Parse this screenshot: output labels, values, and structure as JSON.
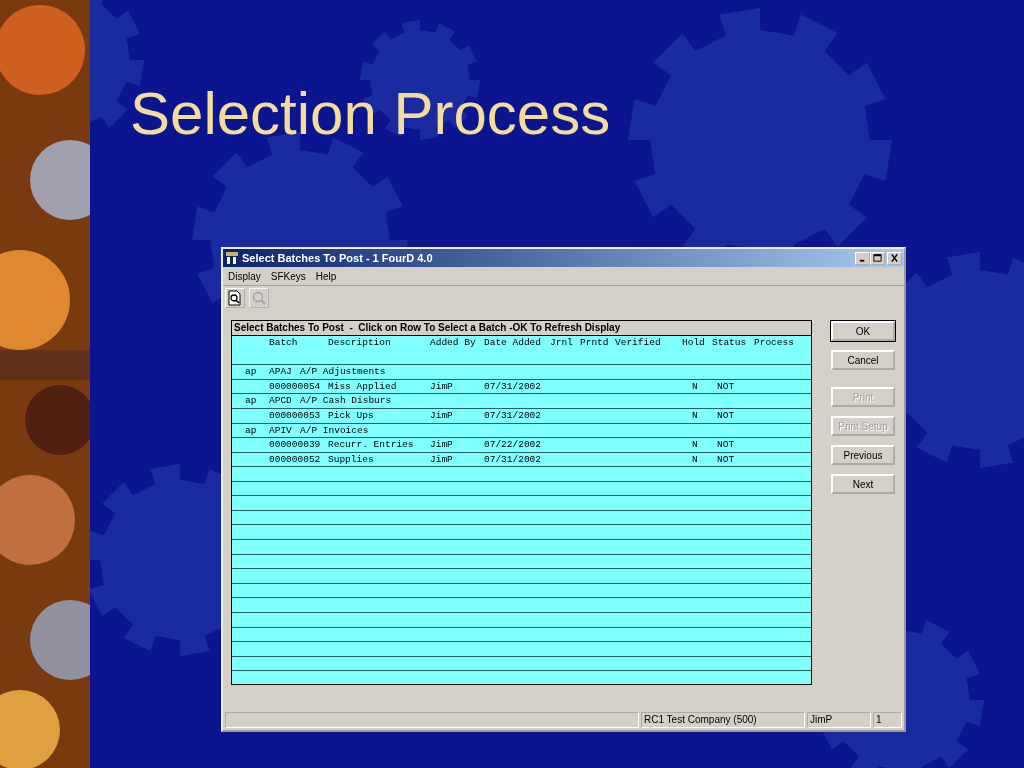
{
  "slide": {
    "title": "Selection Process"
  },
  "window": {
    "title": "Select Batches To Post - 1 FourD 4.0"
  },
  "menu": [
    "Display",
    "SFKeys",
    "Help"
  ],
  "toolbar": [
    {
      "kind": "preview",
      "disabled": false
    },
    {
      "kind": "zoom",
      "disabled": true
    }
  ],
  "grid": {
    "caption": "Select Batches To Post  -  Click on Row To Select a Batch -OK To Refresh Display",
    "columns": [
      "Batch",
      "Description",
      "Added By",
      "Date Added",
      "Jrnl",
      "Prntd",
      "Verified",
      "Hold",
      "Status",
      "Process"
    ],
    "rows": [
      {
        "kind": "group",
        "module": "ap",
        "code": "APAJ",
        "description": "A/P Adjustments"
      },
      {
        "kind": "batch",
        "batch": "000000054",
        "description": "Miss Applied",
        "added_by": "JimP",
        "date_added": "07/31/2002",
        "hold": "N",
        "status": "NOT"
      },
      {
        "kind": "group",
        "module": "ap",
        "code": "APCD",
        "description": "A/P Cash Disburs"
      },
      {
        "kind": "batch",
        "batch": "000000053",
        "description": "Pick Ups",
        "added_by": "JimP",
        "date_added": "07/31/2002",
        "hold": "N",
        "status": "NOT"
      },
      {
        "kind": "group",
        "module": "ap",
        "code": "APIV",
        "description": "A/P Invoices"
      },
      {
        "kind": "batch",
        "batch": "000000039",
        "description": "Recurr. Entries",
        "added_by": "JimP",
        "date_added": "07/22/2002",
        "hold": "N",
        "status": "NOT"
      },
      {
        "kind": "batch",
        "batch": "000000052",
        "description": "Supplies",
        "added_by": "JimP",
        "date_added": "07/31/2002",
        "hold": "N",
        "status": "NOT"
      }
    ]
  },
  "buttons": [
    {
      "label": "OK",
      "disabled": false,
      "focused": true
    },
    {
      "label": "Cancel",
      "disabled": false,
      "focused": false
    },
    {
      "label": "Print",
      "disabled": true,
      "focused": false
    },
    {
      "label": "Print Setup",
      "disabled": true,
      "focused": false
    },
    {
      "label": "Previous",
      "disabled": false,
      "focused": false
    },
    {
      "label": "Next",
      "disabled": false,
      "focused": false
    }
  ],
  "status_bar": [
    "RC1 Test Company (500)",
    "JimP",
    "1"
  ]
}
